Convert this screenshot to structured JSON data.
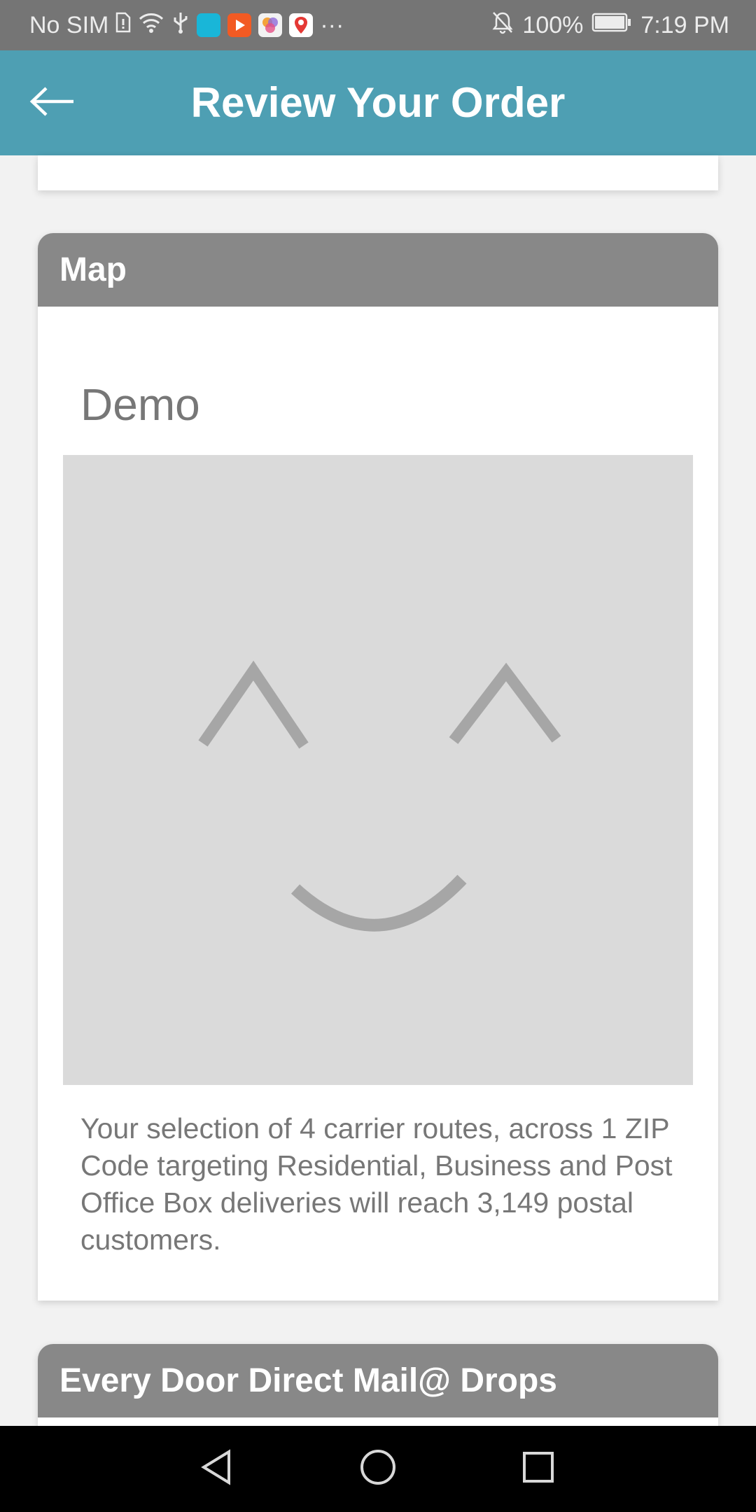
{
  "status_bar": {
    "carrier": "No SIM",
    "battery": "100%",
    "time": "7:19 PM",
    "overflow": "···"
  },
  "app_bar": {
    "title": "Review Your Order",
    "back_icon": "back-arrow-icon"
  },
  "map_section": {
    "header": "Map",
    "map_name": "Demo",
    "placeholder_icon": "smiley-placeholder-icon",
    "summary": "Your selection of 4 carrier routes, across 1 ZIP Code targeting Residential, Business and Post Office Box deliveries will reach 3,149 postal customers."
  },
  "drops_section": {
    "header": "Every Door Direct Mail@ Drops"
  },
  "nav_bar": {
    "back_icon": "nav-back-icon",
    "home_icon": "nav-home-icon",
    "recents_icon": "nav-recents-icon"
  },
  "colors": {
    "app_bar": "#4e9fb3",
    "section_header": "#888888",
    "status_bar": "#757575",
    "map_placeholder_bg": "#dadada"
  }
}
